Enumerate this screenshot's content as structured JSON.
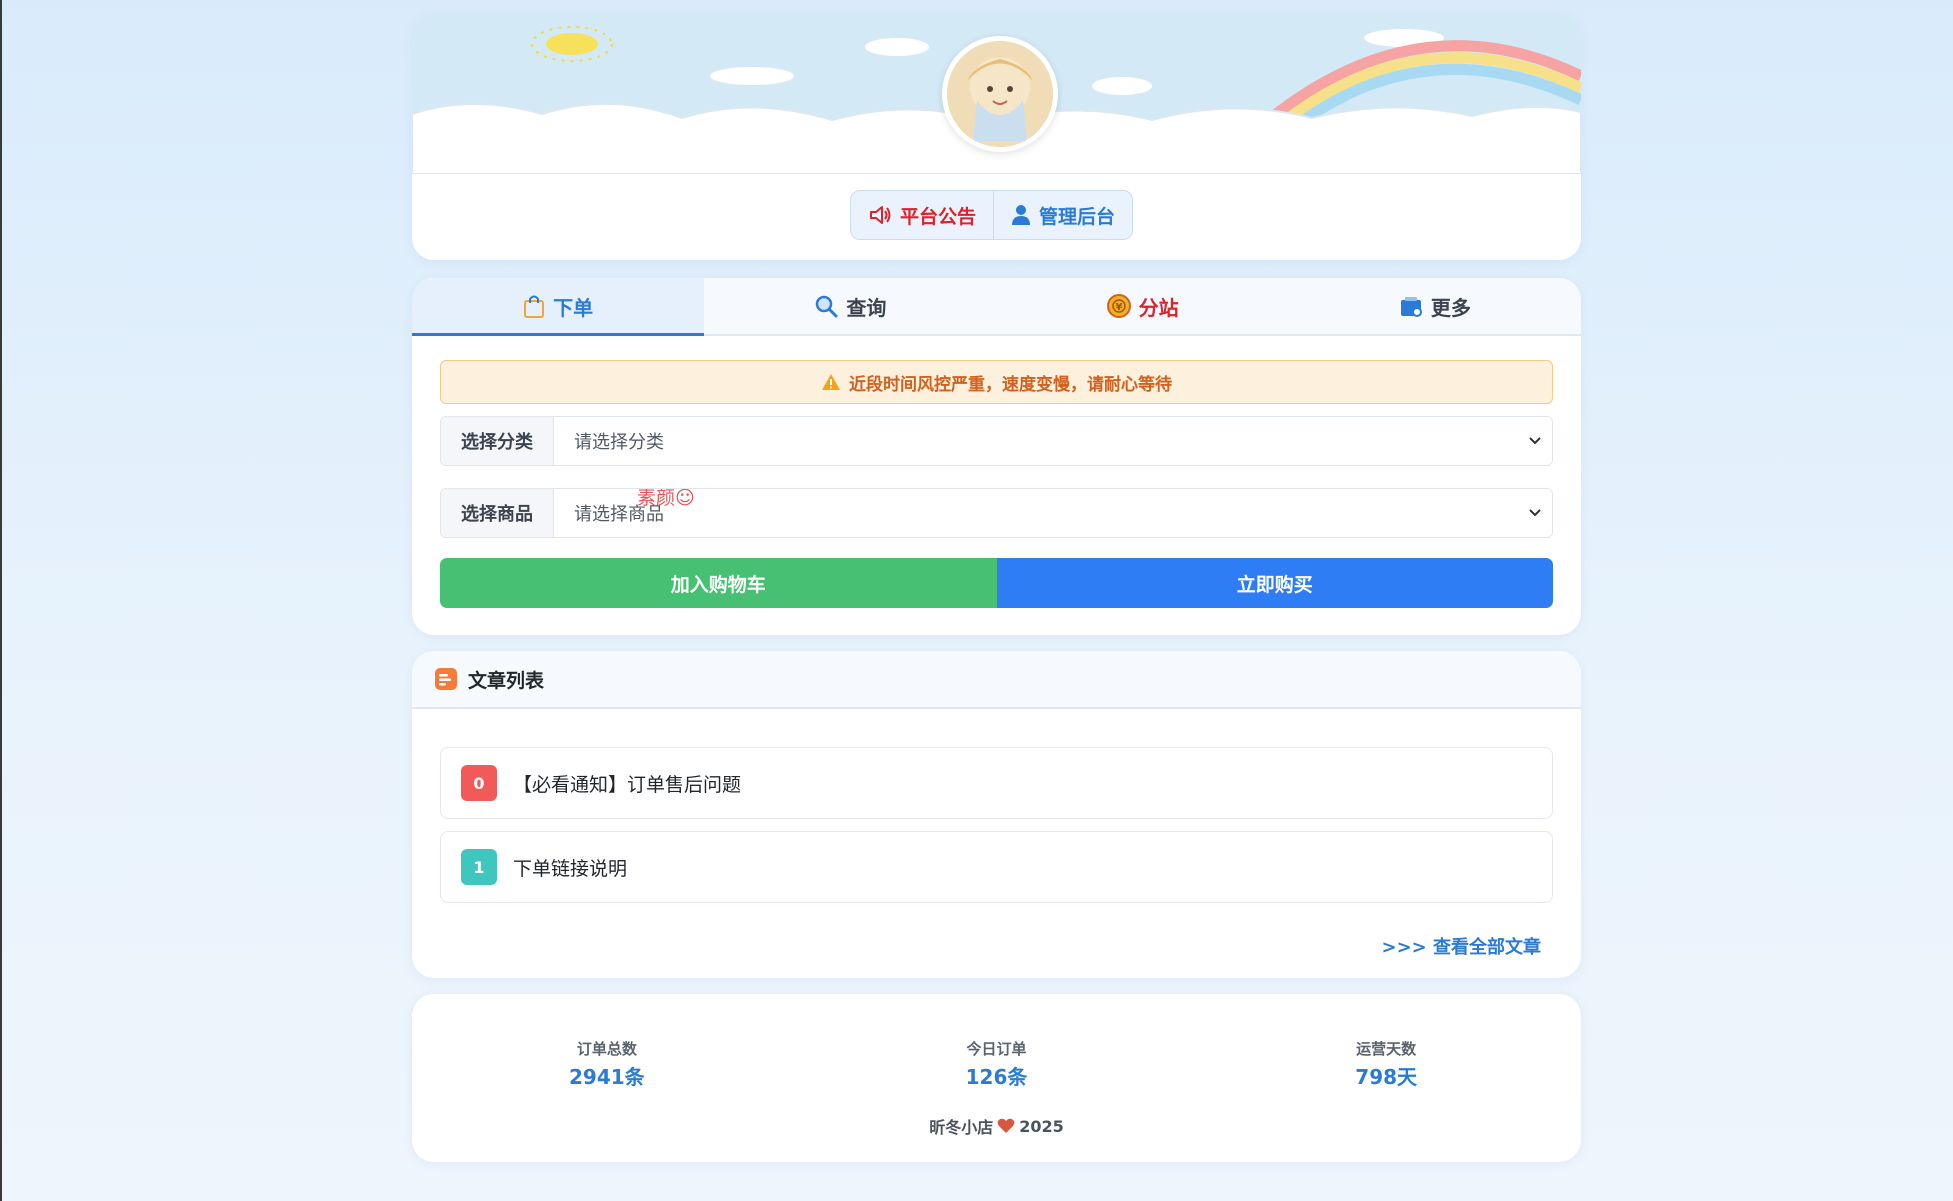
{
  "header": {
    "announcement_label": "平台公告",
    "admin_label": "管理后台"
  },
  "tabs": [
    {
      "label": "下单"
    },
    {
      "label": "查询"
    },
    {
      "label": "分站"
    },
    {
      "label": "更多"
    }
  ],
  "order_form": {
    "alert": "近段时间风控严重，速度变慢，请耐心等待",
    "category_label": "选择分类",
    "category_value": "请选择分类",
    "product_label": "选择商品",
    "product_value": "请选择商品",
    "watermark": "素颜☺",
    "add_to_cart": "加入购物车",
    "buy_now": "立即购买"
  },
  "articles": {
    "title": "文章列表",
    "items": [
      {
        "index": "0",
        "title": "【必看通知】订单售后问题"
      },
      {
        "index": "1",
        "title": "下单链接说明"
      }
    ],
    "view_all": ">>> 查看全部文章"
  },
  "stats": {
    "items": [
      {
        "label": "订单总数",
        "value": "2941条"
      },
      {
        "label": "今日订单",
        "value": "126条"
      },
      {
        "label": "运营天数",
        "value": "798天"
      }
    ],
    "footer_name": "昕冬小店",
    "footer_year": "2025"
  },
  "colors": {
    "accent_blue": "#2b7bd6",
    "cart_green": "#47c073",
    "buy_blue": "#2f7df5",
    "alert_orange": "#d2611f",
    "announce_red": "#e0202a"
  }
}
